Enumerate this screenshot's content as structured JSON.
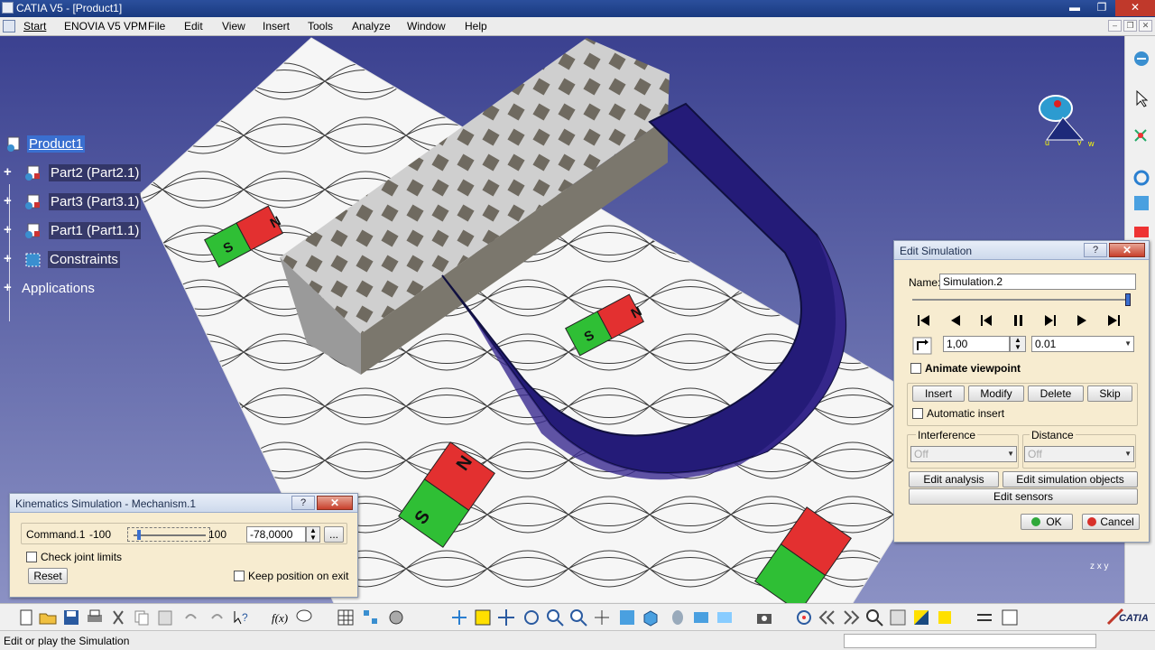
{
  "window": {
    "title": "CATIA V5 - [Product1]",
    "minimize": "▬",
    "maximize": "❐",
    "close": "✕"
  },
  "menu": {
    "items": [
      "Start",
      "ENOVIA V5 VPM",
      "File",
      "Edit",
      "View",
      "Insert",
      "Tools",
      "Analyze",
      "Window",
      "Help"
    ],
    "mdi_controls": [
      "–",
      "❐",
      "✕"
    ]
  },
  "tree": {
    "nodes": [
      {
        "label": "Product1",
        "selected": true
      },
      {
        "label": "Part2 (Part2.1)"
      },
      {
        "label": "Part3 (Part3.1)"
      },
      {
        "label": "Part1 (Part1.1)"
      },
      {
        "label": "Constraints"
      },
      {
        "label": "Applications"
      }
    ]
  },
  "scene": {
    "magnet_labels": {
      "south": "S",
      "north": "N"
    },
    "compass_axes": {
      "u": "u",
      "v": "v",
      "w": "w"
    },
    "axis_label": "z x y",
    "colors": {
      "north": "#e33030",
      "south": "#2fbf35",
      "horseshoe": "#241b78",
      "field_bg": "#f6f6f6"
    }
  },
  "edit_simulation": {
    "title": "Edit Simulation",
    "help": "?",
    "close": "✕",
    "name_label": "Name:",
    "name_value": "Simulation.2",
    "slider_position": 1.0,
    "step_value": "1,00",
    "interval_value": "0.01",
    "animate_viewpoint": "Animate viewpoint",
    "insert": "Insert",
    "modify": "Modify",
    "delete": "Delete",
    "skip": "Skip",
    "automatic_insert": "Automatic insert",
    "interference_label": "Interference",
    "interference_value": "Off",
    "distance_label": "Distance",
    "distance_value": "Off",
    "edit_analysis": "Edit analysis",
    "edit_sim_objects": "Edit simulation objects",
    "edit_sensors": "Edit sensors",
    "ok": "OK",
    "cancel": "Cancel"
  },
  "kinematics": {
    "title": "Kinematics Simulation - Mechanism.1",
    "help": "?",
    "close": "✕",
    "command_label": "Command.1",
    "min": "-100",
    "max": "100",
    "value": "-78,0000",
    "more": "...",
    "check_joint_limits": "Check joint limits",
    "reset": "Reset",
    "keep_position": "Keep position on exit"
  },
  "status": {
    "text": "Edit or play the Simulation"
  },
  "brand": {
    "logo_text": "CATIA"
  }
}
